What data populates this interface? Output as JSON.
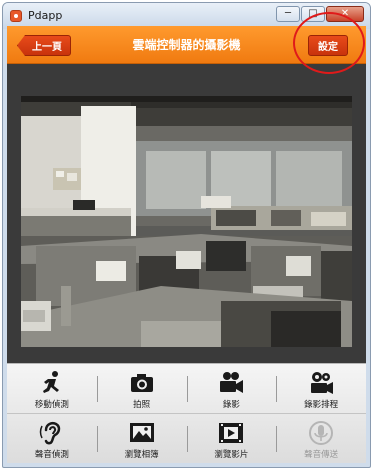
{
  "window": {
    "title": "Pdapp",
    "minimize": "─",
    "maximize": "□",
    "close": "✕"
  },
  "header": {
    "back_label": "上一頁",
    "title": "雲端控制器的攝影機",
    "settings_label": "設定"
  },
  "colors": {
    "header_orange": "#f58a1c",
    "button_red": "#d63d12",
    "highlight_ring": "#e01a1a"
  },
  "toolbar": {
    "row1": [
      {
        "label": "移動偵測",
        "icon": "running-person-icon",
        "enabled": true
      },
      {
        "label": "拍照",
        "icon": "camera-icon",
        "enabled": true
      },
      {
        "label": "錄影",
        "icon": "video-camera-icon",
        "enabled": true
      },
      {
        "label": "錄影排程",
        "icon": "film-reel-icon",
        "enabled": true
      }
    ],
    "row2": [
      {
        "label": "聲音偵測",
        "icon": "ear-icon",
        "enabled": true
      },
      {
        "label": "瀏覽相簿",
        "icon": "photo-album-icon",
        "enabled": true
      },
      {
        "label": "瀏覽影片",
        "icon": "video-film-icon",
        "enabled": true
      },
      {
        "label": "聲音傳送",
        "icon": "microphone-icon",
        "enabled": false
      }
    ]
  }
}
